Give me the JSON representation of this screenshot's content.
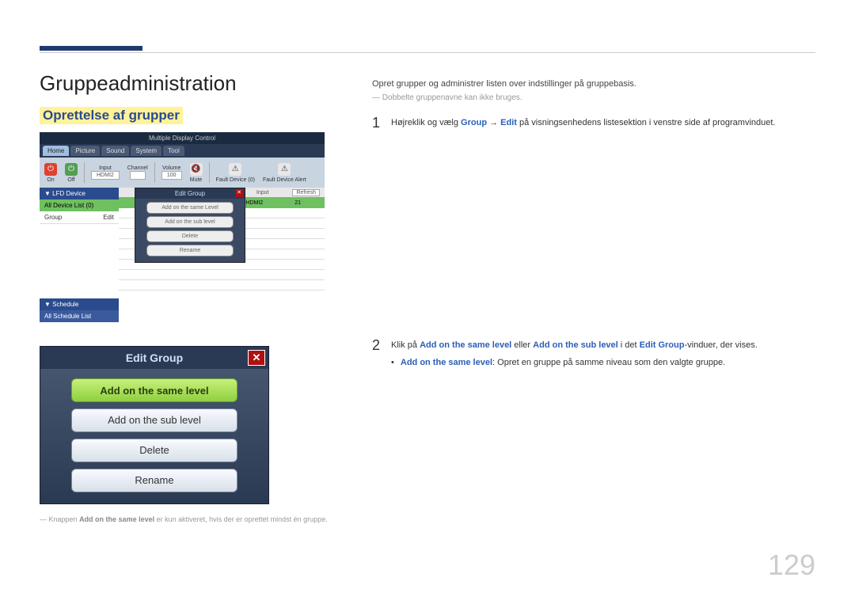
{
  "page_number": "129",
  "title": "Gruppeadministration",
  "subtitle": "Oprettelse af grupper",
  "intro": "Opret grupper og administrer listen over indstillinger på gruppebasis.",
  "note_duplicate": "Dobbelte gruppenavne kan ikke bruges.",
  "step1": {
    "num": "1",
    "pre": "Højreklik og vælg ",
    "group": "Group",
    "arrow": " → ",
    "edit": "Edit",
    "post": " på visningsenhedens listesektion i venstre side af programvinduet."
  },
  "step2": {
    "num": "2",
    "pre": "Klik på ",
    "b1": "Add on the same level",
    "mid": " eller ",
    "b2": "Add on the sub level",
    "mid2": " i det ",
    "b3": "Edit Group",
    "post": "-vinduer, der vises.",
    "bullet_label": "Add on the same level",
    "bullet_text": ": Opret en gruppe på samme niveau som den valgte gruppe."
  },
  "footnote": {
    "pre": "Knappen ",
    "b": "Add on the same level",
    "post": " er kun aktiveret, hvis der er oprettet mindst én gruppe."
  },
  "shot1": {
    "app_title": "Multiple Display Control",
    "tabs": [
      "Home",
      "Picture",
      "Sound",
      "System",
      "Tool"
    ],
    "ribbon_on": "On",
    "ribbon_off": "Off",
    "input_label": "Input",
    "input_value": "HDMI2",
    "channel_label": "Channel",
    "volume_label": "Volume",
    "volume_value": "100",
    "mute_label": "Mute",
    "fault_id": "Fault Device (0)",
    "fault_alert": "Fault Device Alert",
    "side_lfd": "LFD Device",
    "side_all": "All Device List (0)",
    "side_group": "Group",
    "side_edit": "Edit",
    "side_schedule": "Schedule",
    "side_all_schedule": "All Schedule List",
    "refresh": "Refresh",
    "grid_input": "Input",
    "grid_hdmi": "HDMI2",
    "popup_title": "Edit Group",
    "popup_items": [
      "Add on the same Level",
      "Add on the sub level",
      "Delete",
      "Rename"
    ]
  },
  "shot2": {
    "title": "Edit Group",
    "items": [
      "Add on the same level",
      "Add on the sub level",
      "Delete",
      "Rename"
    ]
  }
}
